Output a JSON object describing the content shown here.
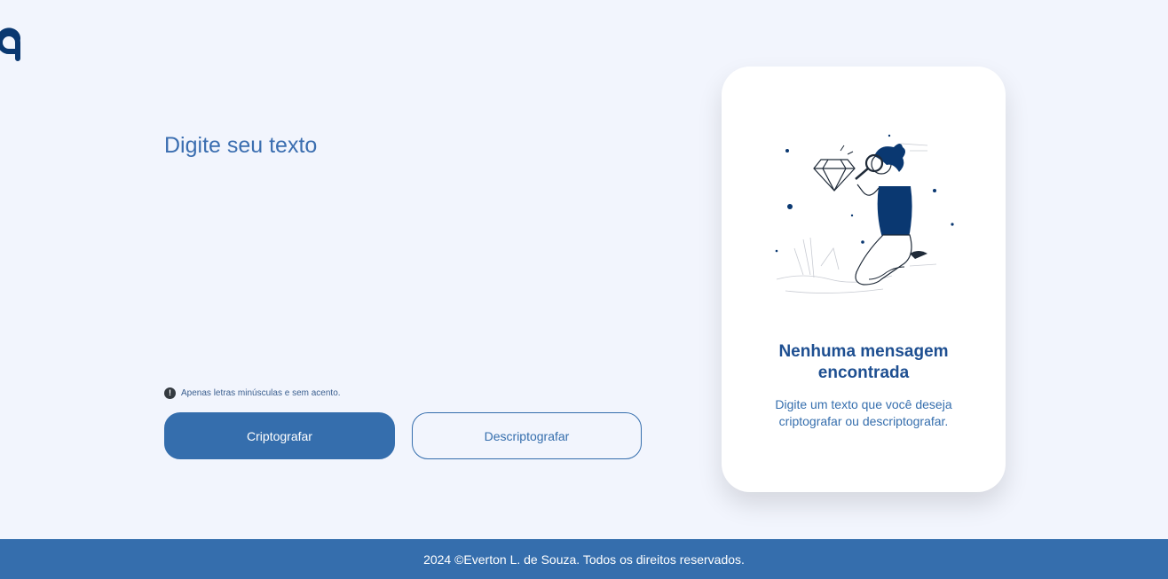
{
  "header": {
    "logo_icon": "alura-logo-icon"
  },
  "input": {
    "placeholder": "Digite seu texto",
    "value": ""
  },
  "hint": {
    "icon": "exclamation-icon",
    "text": "Apenas letras minúsculas e sem acento."
  },
  "buttons": {
    "encrypt_label": "Criptografar",
    "decrypt_label": "Descriptografar"
  },
  "output": {
    "illustration": "person-with-magnifying-glass-illustration",
    "title": "Nenhuma mensagem encontrada",
    "description": "Digite um texto que você deseja criptografar ou descriptografar."
  },
  "footer": {
    "text": "2024 ©Everton L. de Souza. Todos os direitos reservados."
  },
  "colors": {
    "background": "#f2f5fd",
    "primary": "#356ead",
    "dark_blue": "#0a3871",
    "card": "#ffffff"
  }
}
